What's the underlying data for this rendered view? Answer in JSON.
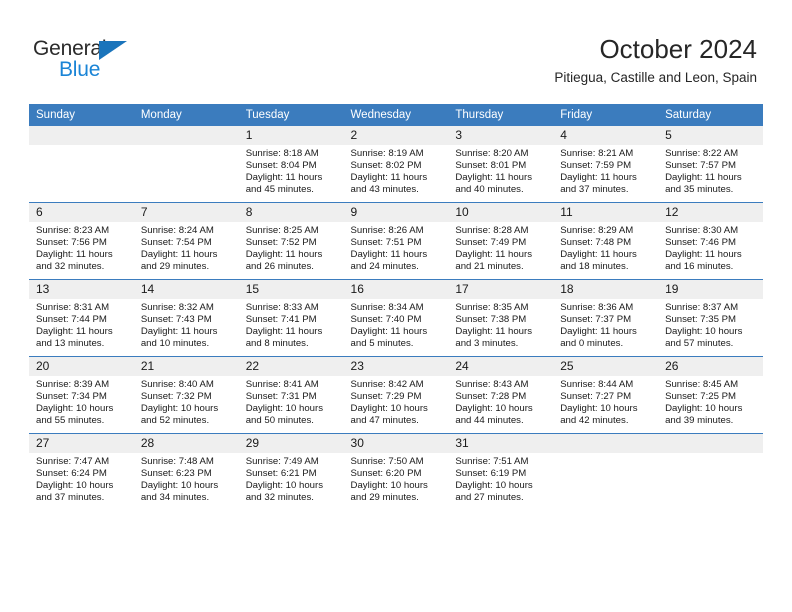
{
  "brand": {
    "name_top": "General",
    "name_bottom": "Blue",
    "triangle_icon": "triangle-icon",
    "accent_color": "#1a84d6"
  },
  "header": {
    "title": "October 2024",
    "location": "Pitiegua, Castille and Leon, Spain"
  },
  "theme": {
    "header_blue": "#3b7cbe",
    "daynum_gray": "#efefef",
    "text": "#1a1a1a"
  },
  "weekday_headers": [
    "Sunday",
    "Monday",
    "Tuesday",
    "Wednesday",
    "Thursday",
    "Friday",
    "Saturday"
  ],
  "labels": {
    "sunrise": "Sunrise:",
    "sunset": "Sunset:",
    "daylight": "Daylight:"
  },
  "weeks": [
    [
      {
        "day": "",
        "sunrise": "",
        "sunset": "",
        "daylight_1": "",
        "daylight_2": ""
      },
      {
        "day": "",
        "sunrise": "",
        "sunset": "",
        "daylight_1": "",
        "daylight_2": ""
      },
      {
        "day": "1",
        "sunrise": "Sunrise: 8:18 AM",
        "sunset": "Sunset: 8:04 PM",
        "daylight_1": "Daylight: 11 hours",
        "daylight_2": "and 45 minutes."
      },
      {
        "day": "2",
        "sunrise": "Sunrise: 8:19 AM",
        "sunset": "Sunset: 8:02 PM",
        "daylight_1": "Daylight: 11 hours",
        "daylight_2": "and 43 minutes."
      },
      {
        "day": "3",
        "sunrise": "Sunrise: 8:20 AM",
        "sunset": "Sunset: 8:01 PM",
        "daylight_1": "Daylight: 11 hours",
        "daylight_2": "and 40 minutes."
      },
      {
        "day": "4",
        "sunrise": "Sunrise: 8:21 AM",
        "sunset": "Sunset: 7:59 PM",
        "daylight_1": "Daylight: 11 hours",
        "daylight_2": "and 37 minutes."
      },
      {
        "day": "5",
        "sunrise": "Sunrise: 8:22 AM",
        "sunset": "Sunset: 7:57 PM",
        "daylight_1": "Daylight: 11 hours",
        "daylight_2": "and 35 minutes."
      }
    ],
    [
      {
        "day": "6",
        "sunrise": "Sunrise: 8:23 AM",
        "sunset": "Sunset: 7:56 PM",
        "daylight_1": "Daylight: 11 hours",
        "daylight_2": "and 32 minutes."
      },
      {
        "day": "7",
        "sunrise": "Sunrise: 8:24 AM",
        "sunset": "Sunset: 7:54 PM",
        "daylight_1": "Daylight: 11 hours",
        "daylight_2": "and 29 minutes."
      },
      {
        "day": "8",
        "sunrise": "Sunrise: 8:25 AM",
        "sunset": "Sunset: 7:52 PM",
        "daylight_1": "Daylight: 11 hours",
        "daylight_2": "and 26 minutes."
      },
      {
        "day": "9",
        "sunrise": "Sunrise: 8:26 AM",
        "sunset": "Sunset: 7:51 PM",
        "daylight_1": "Daylight: 11 hours",
        "daylight_2": "and 24 minutes."
      },
      {
        "day": "10",
        "sunrise": "Sunrise: 8:28 AM",
        "sunset": "Sunset: 7:49 PM",
        "daylight_1": "Daylight: 11 hours",
        "daylight_2": "and 21 minutes."
      },
      {
        "day": "11",
        "sunrise": "Sunrise: 8:29 AM",
        "sunset": "Sunset: 7:48 PM",
        "daylight_1": "Daylight: 11 hours",
        "daylight_2": "and 18 minutes."
      },
      {
        "day": "12",
        "sunrise": "Sunrise: 8:30 AM",
        "sunset": "Sunset: 7:46 PM",
        "daylight_1": "Daylight: 11 hours",
        "daylight_2": "and 16 minutes."
      }
    ],
    [
      {
        "day": "13",
        "sunrise": "Sunrise: 8:31 AM",
        "sunset": "Sunset: 7:44 PM",
        "daylight_1": "Daylight: 11 hours",
        "daylight_2": "and 13 minutes."
      },
      {
        "day": "14",
        "sunrise": "Sunrise: 8:32 AM",
        "sunset": "Sunset: 7:43 PM",
        "daylight_1": "Daylight: 11 hours",
        "daylight_2": "and 10 minutes."
      },
      {
        "day": "15",
        "sunrise": "Sunrise: 8:33 AM",
        "sunset": "Sunset: 7:41 PM",
        "daylight_1": "Daylight: 11 hours",
        "daylight_2": "and 8 minutes."
      },
      {
        "day": "16",
        "sunrise": "Sunrise: 8:34 AM",
        "sunset": "Sunset: 7:40 PM",
        "daylight_1": "Daylight: 11 hours",
        "daylight_2": "and 5 minutes."
      },
      {
        "day": "17",
        "sunrise": "Sunrise: 8:35 AM",
        "sunset": "Sunset: 7:38 PM",
        "daylight_1": "Daylight: 11 hours",
        "daylight_2": "and 3 minutes."
      },
      {
        "day": "18",
        "sunrise": "Sunrise: 8:36 AM",
        "sunset": "Sunset: 7:37 PM",
        "daylight_1": "Daylight: 11 hours",
        "daylight_2": "and 0 minutes."
      },
      {
        "day": "19",
        "sunrise": "Sunrise: 8:37 AM",
        "sunset": "Sunset: 7:35 PM",
        "daylight_1": "Daylight: 10 hours",
        "daylight_2": "and 57 minutes."
      }
    ],
    [
      {
        "day": "20",
        "sunrise": "Sunrise: 8:39 AM",
        "sunset": "Sunset: 7:34 PM",
        "daylight_1": "Daylight: 10 hours",
        "daylight_2": "and 55 minutes."
      },
      {
        "day": "21",
        "sunrise": "Sunrise: 8:40 AM",
        "sunset": "Sunset: 7:32 PM",
        "daylight_1": "Daylight: 10 hours",
        "daylight_2": "and 52 minutes."
      },
      {
        "day": "22",
        "sunrise": "Sunrise: 8:41 AM",
        "sunset": "Sunset: 7:31 PM",
        "daylight_1": "Daylight: 10 hours",
        "daylight_2": "and 50 minutes."
      },
      {
        "day": "23",
        "sunrise": "Sunrise: 8:42 AM",
        "sunset": "Sunset: 7:29 PM",
        "daylight_1": "Daylight: 10 hours",
        "daylight_2": "and 47 minutes."
      },
      {
        "day": "24",
        "sunrise": "Sunrise: 8:43 AM",
        "sunset": "Sunset: 7:28 PM",
        "daylight_1": "Daylight: 10 hours",
        "daylight_2": "and 44 minutes."
      },
      {
        "day": "25",
        "sunrise": "Sunrise: 8:44 AM",
        "sunset": "Sunset: 7:27 PM",
        "daylight_1": "Daylight: 10 hours",
        "daylight_2": "and 42 minutes."
      },
      {
        "day": "26",
        "sunrise": "Sunrise: 8:45 AM",
        "sunset": "Sunset: 7:25 PM",
        "daylight_1": "Daylight: 10 hours",
        "daylight_2": "and 39 minutes."
      }
    ],
    [
      {
        "day": "27",
        "sunrise": "Sunrise: 7:47 AM",
        "sunset": "Sunset: 6:24 PM",
        "daylight_1": "Daylight: 10 hours",
        "daylight_2": "and 37 minutes."
      },
      {
        "day": "28",
        "sunrise": "Sunrise: 7:48 AM",
        "sunset": "Sunset: 6:23 PM",
        "daylight_1": "Daylight: 10 hours",
        "daylight_2": "and 34 minutes."
      },
      {
        "day": "29",
        "sunrise": "Sunrise: 7:49 AM",
        "sunset": "Sunset: 6:21 PM",
        "daylight_1": "Daylight: 10 hours",
        "daylight_2": "and 32 minutes."
      },
      {
        "day": "30",
        "sunrise": "Sunrise: 7:50 AM",
        "sunset": "Sunset: 6:20 PM",
        "daylight_1": "Daylight: 10 hours",
        "daylight_2": "and 29 minutes."
      },
      {
        "day": "31",
        "sunrise": "Sunrise: 7:51 AM",
        "sunset": "Sunset: 6:19 PM",
        "daylight_1": "Daylight: 10 hours",
        "daylight_2": "and 27 minutes."
      },
      {
        "day": "",
        "sunrise": "",
        "sunset": "",
        "daylight_1": "",
        "daylight_2": ""
      },
      {
        "day": "",
        "sunrise": "",
        "sunset": "",
        "daylight_1": "",
        "daylight_2": ""
      }
    ]
  ]
}
